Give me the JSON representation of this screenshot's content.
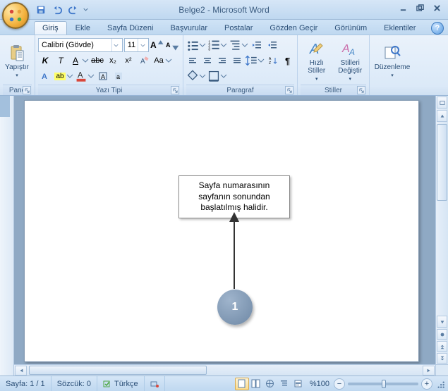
{
  "title": "Belge2 - Microsoft Word",
  "tabs": [
    "Giriş",
    "Ekle",
    "Sayfa Düzeni",
    "Başvurular",
    "Postalar",
    "Gözden Geçir",
    "Görünüm",
    "Eklentiler"
  ],
  "clipboard": {
    "paste": "Yapıştır",
    "label": "Pano"
  },
  "font": {
    "name": "Calibri (Gövde)",
    "size": "11",
    "label": "Yazı Tipi",
    "bold": "K",
    "italic": "T",
    "underline": "A",
    "strike": "abc",
    "sub": "x₂",
    "sup": "x²",
    "ab": "ab",
    "case": "Aa",
    "highlight": "ab",
    "grow": "A",
    "shrink": "A",
    "clear": "A"
  },
  "paragraph": {
    "label": "Paragraf"
  },
  "styles": {
    "quick": "Hızlı Stiller",
    "change": "Stilleri Değiştir",
    "label": "Stiller"
  },
  "editing": {
    "label": "Düzenleme"
  },
  "callout_text": "Sayfa numarasının sayfanın sonundan başlatılmış halidir.",
  "page_number": "1",
  "status": {
    "page": "Sayfa: 1 / 1",
    "words": "Sözcük: 0",
    "lang": "Türkçe",
    "zoom": "%100"
  }
}
